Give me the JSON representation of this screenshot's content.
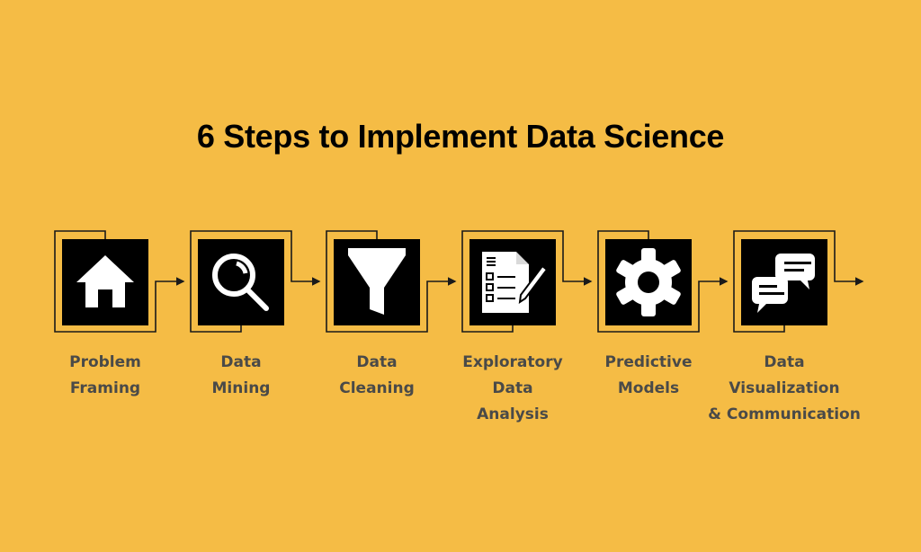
{
  "title": "6 Steps to Implement Data Science",
  "colors": {
    "background": "#F5BC45",
    "box": "#000000",
    "icon": "#FFFFFF",
    "connector": "#1A1A1A",
    "label": "#4A4A48",
    "title": "#000000"
  },
  "steps": [
    {
      "icon": "house-icon",
      "label_lines": [
        "Problem",
        "Framing"
      ]
    },
    {
      "icon": "magnifier-icon",
      "label_lines": [
        "Data",
        "Mining"
      ]
    },
    {
      "icon": "funnel-icon",
      "label_lines": [
        "Data",
        "Cleaning"
      ]
    },
    {
      "icon": "document-pencil-icon",
      "label_lines": [
        "Exploratory",
        "Data",
        "Analysis"
      ]
    },
    {
      "icon": "gear-icon",
      "label_lines": [
        "Predictive",
        "Models"
      ]
    },
    {
      "icon": "chat-bubbles-icon",
      "label_lines": [
        "Data",
        "Visualization",
        "& Communication"
      ]
    }
  ]
}
